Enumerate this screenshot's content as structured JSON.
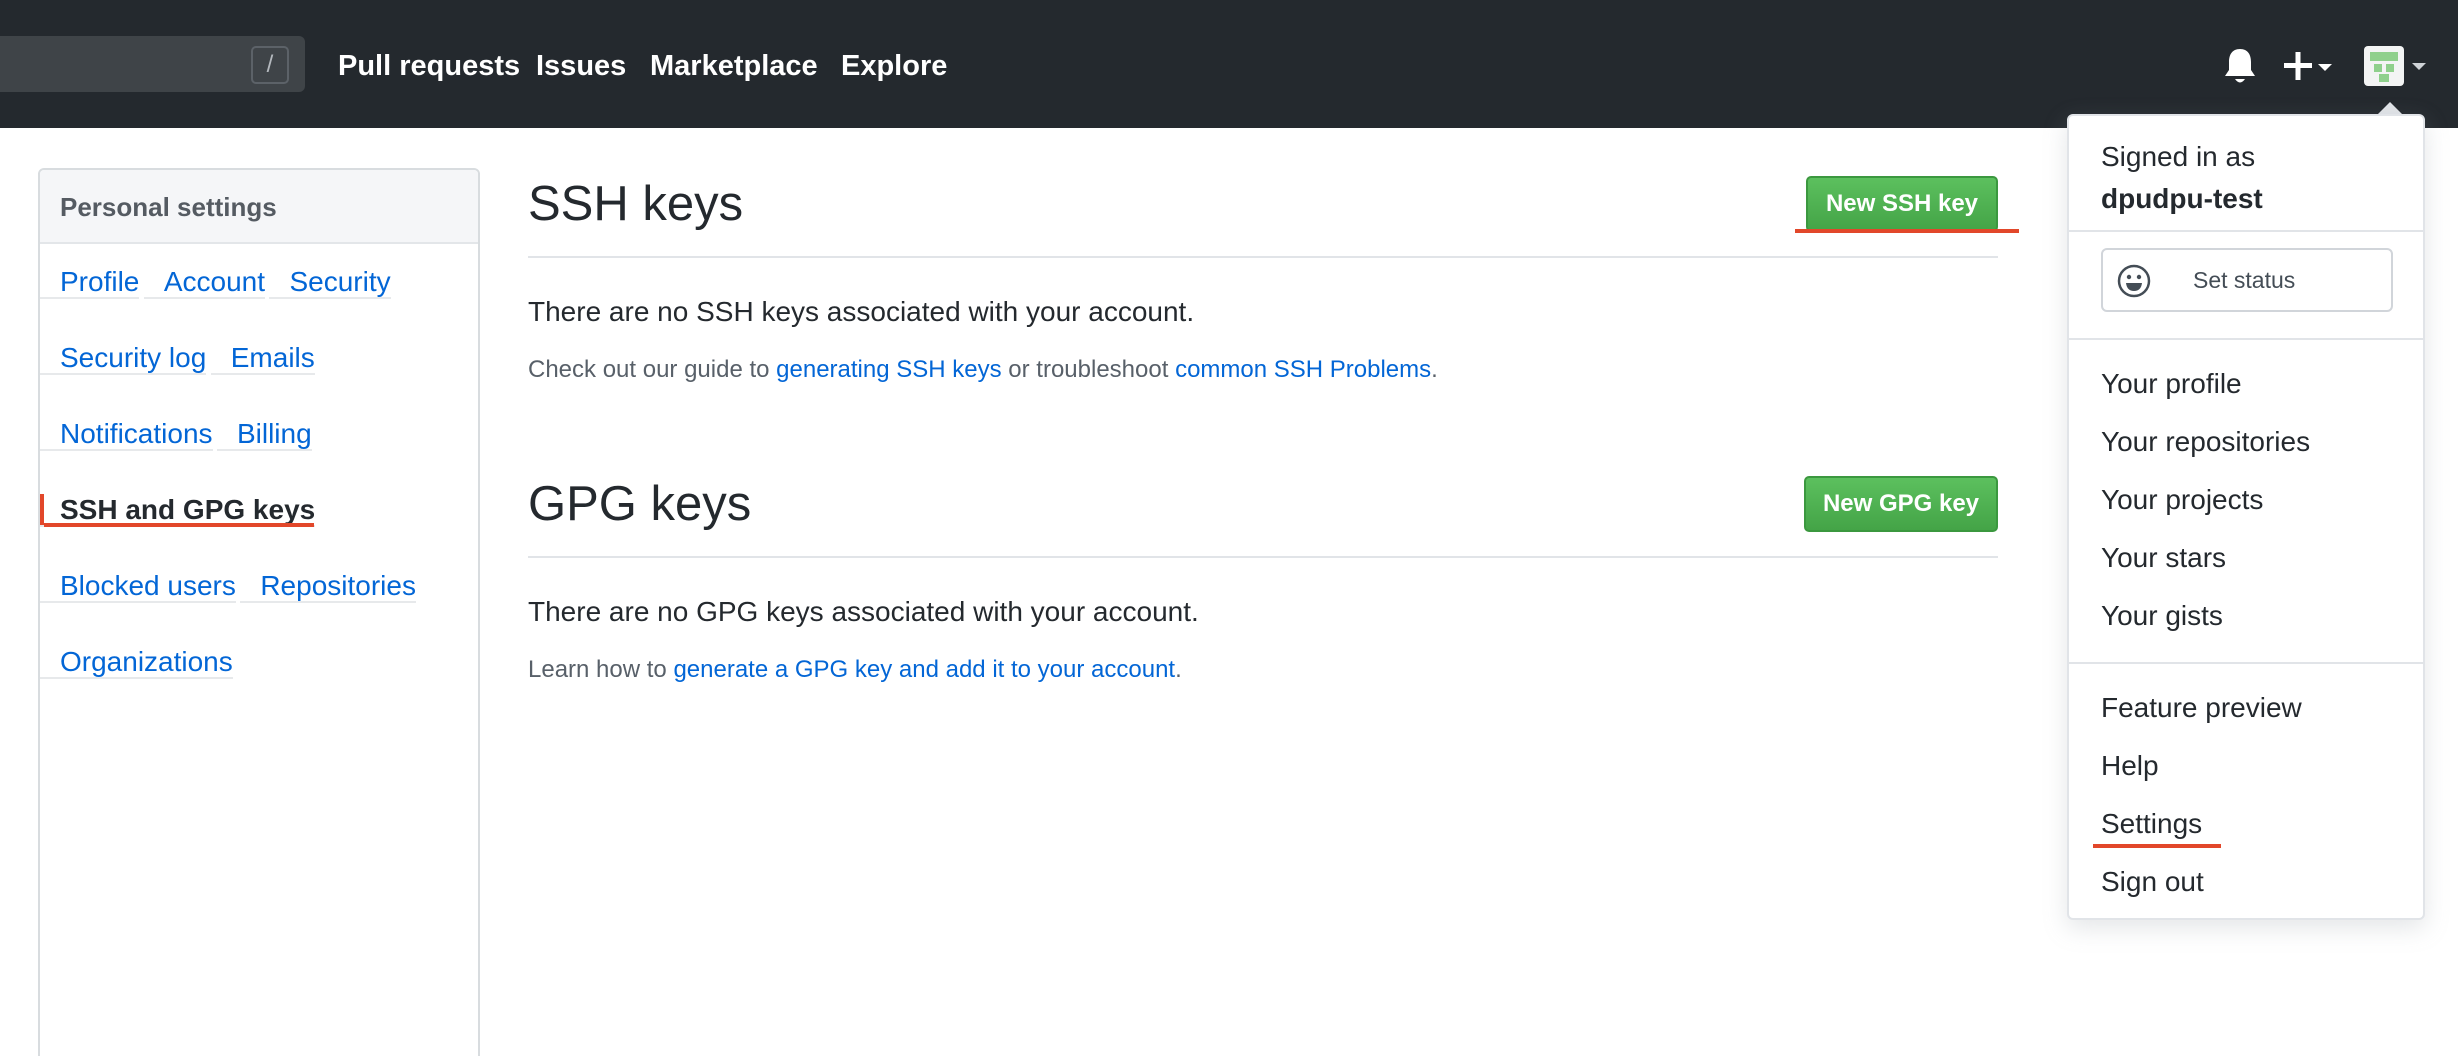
{
  "header": {
    "search_shortcut": "/",
    "nav": [
      "Pull requests",
      "Issues",
      "Marketplace",
      "Explore"
    ],
    "icons": {
      "notifications": "bell-icon",
      "create": "plus-icon",
      "avatar": "avatar-icon"
    }
  },
  "sidebar": {
    "heading": "Personal settings",
    "items": [
      "Profile",
      "Account",
      "Security",
      "Security log",
      "Emails",
      "Notifications",
      "Billing",
      "SSH and GPG keys",
      "Blocked users",
      "Repositories",
      "Organizations"
    ],
    "selected": "SSH and GPG keys"
  },
  "ssh": {
    "title": "SSH keys",
    "button": "New SSH key",
    "empty_message": "There are no SSH keys associated with your account.",
    "note_prefix": "Check out our guide to ",
    "link1": "generating SSH keys",
    "note_mid": " or troubleshoot ",
    "link2": "common SSH Problems",
    "note_suffix": "."
  },
  "gpg": {
    "title": "GPG keys",
    "button": "New GPG key",
    "empty_message": "There are no GPG keys associated with your account.",
    "note_prefix": "Learn how to ",
    "link": "generate a GPG key and add it to your account",
    "note_suffix": "."
  },
  "dropdown": {
    "signed_in_as": "Signed in as",
    "username": "dpudpu-test",
    "set_status": "Set status",
    "items_group1": [
      "Your profile",
      "Your repositories",
      "Your projects",
      "Your stars",
      "Your gists"
    ],
    "items_group2": [
      "Feature preview",
      "Help",
      "Settings",
      "Sign out"
    ]
  },
  "colors": {
    "header_bg": "#24292e",
    "link": "#0366d6",
    "primary_green": "#4fb151",
    "annotation_red": "#e2472a"
  }
}
